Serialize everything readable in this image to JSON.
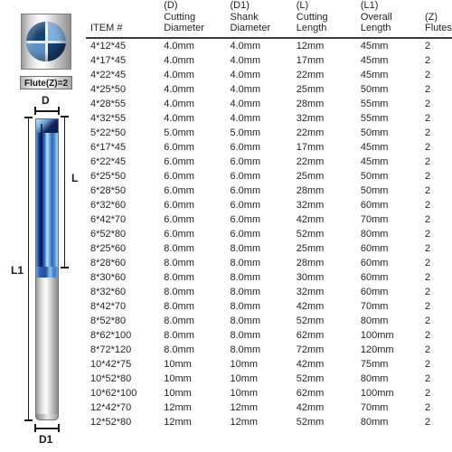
{
  "diagram": {
    "cross_section_caption": "Flute(Z)=2",
    "dimensions": {
      "cutting_diameter": "D",
      "shank_diameter": "D1",
      "cutting_length": "L",
      "overall_length": "L1"
    },
    "colors": {
      "coating_dark": "#0e1f6b",
      "coating_mid": "#2f6fc4",
      "coating_light": "#bfe0f4",
      "shank_steel": "#dadada",
      "outline": "#6f6f6f"
    }
  },
  "table": {
    "headers": [
      {
        "code": "",
        "line1": "",
        "line2": "ITEM #"
      },
      {
        "code": "(D)",
        "line1": "Cutting",
        "line2": "Diameter"
      },
      {
        "code": "(D1)",
        "line1": "Shank",
        "line2": "Diameter"
      },
      {
        "code": "(L)",
        "line1": "Cutting",
        "line2": "Length"
      },
      {
        "code": "(L1)",
        "line1": "Overall",
        "line2": "Length"
      },
      {
        "code": "(Z)",
        "line1": "",
        "line2": "Flutes"
      }
    ],
    "rows": [
      {
        "item": "4*12*45",
        "cutting_diameter": "4.0mm",
        "shank_diameter": "4.0mm",
        "cutting_length": "12mm",
        "overall_length": "45mm",
        "flutes": "2"
      },
      {
        "item": "4*17*45",
        "cutting_diameter": "4.0mm",
        "shank_diameter": "4.0mm",
        "cutting_length": "17mm",
        "overall_length": "45mm",
        "flutes": "2"
      },
      {
        "item": "4*22*45",
        "cutting_diameter": "4.0mm",
        "shank_diameter": "4.0mm",
        "cutting_length": "22mm",
        "overall_length": "45mm",
        "flutes": "2"
      },
      {
        "item": "4*25*50",
        "cutting_diameter": "4.0mm",
        "shank_diameter": "4.0mm",
        "cutting_length": "25mm",
        "overall_length": "50mm",
        "flutes": "2"
      },
      {
        "item": "4*28*55",
        "cutting_diameter": "4.0mm",
        "shank_diameter": "4.0mm",
        "cutting_length": "28mm",
        "overall_length": "55mm",
        "flutes": "2"
      },
      {
        "item": "4*32*55",
        "cutting_diameter": "4.0mm",
        "shank_diameter": "4.0mm",
        "cutting_length": "32mm",
        "overall_length": "55mm",
        "flutes": "2"
      },
      {
        "item": "5*22*50",
        "cutting_diameter": "5.0mm",
        "shank_diameter": "5.0mm",
        "cutting_length": "22mm",
        "overall_length": "50mm",
        "flutes": "2"
      },
      {
        "item": "6*17*45",
        "cutting_diameter": "6.0mm",
        "shank_diameter": "6.0mm",
        "cutting_length": "17mm",
        "overall_length": "45mm",
        "flutes": "2"
      },
      {
        "item": "6*22*45",
        "cutting_diameter": "6.0mm",
        "shank_diameter": "6.0mm",
        "cutting_length": "22mm",
        "overall_length": "45mm",
        "flutes": "2"
      },
      {
        "item": "6*25*50",
        "cutting_diameter": "6.0mm",
        "shank_diameter": "6.0mm",
        "cutting_length": "25mm",
        "overall_length": "50mm",
        "flutes": "2"
      },
      {
        "item": "6*28*50",
        "cutting_diameter": "6.0mm",
        "shank_diameter": "6.0mm",
        "cutting_length": "28mm",
        "overall_length": "50mm",
        "flutes": "2"
      },
      {
        "item": "6*32*60",
        "cutting_diameter": "6.0mm",
        "shank_diameter": "6.0mm",
        "cutting_length": "32mm",
        "overall_length": "60mm",
        "flutes": "2"
      },
      {
        "item": "6*42*70",
        "cutting_diameter": "6.0mm",
        "shank_diameter": "6.0mm",
        "cutting_length": "42mm",
        "overall_length": "70mm",
        "flutes": "2"
      },
      {
        "item": "6*52*80",
        "cutting_diameter": "6.0mm",
        "shank_diameter": "6.0mm",
        "cutting_length": "52mm",
        "overall_length": "80mm",
        "flutes": "2"
      },
      {
        "item": "8*25*60",
        "cutting_diameter": "8.0mm",
        "shank_diameter": "8.0mm",
        "cutting_length": "25mm",
        "overall_length": "60mm",
        "flutes": "2"
      },
      {
        "item": "8*28*60",
        "cutting_diameter": "8.0mm",
        "shank_diameter": "8.0mm",
        "cutting_length": "28mm",
        "overall_length": "60mm",
        "flutes": "2"
      },
      {
        "item": "8*30*60",
        "cutting_diameter": "8.0mm",
        "shank_diameter": "8.0mm",
        "cutting_length": "30mm",
        "overall_length": "60mm",
        "flutes": "2"
      },
      {
        "item": "8*32*60",
        "cutting_diameter": "8.0mm",
        "shank_diameter": "8.0mm",
        "cutting_length": "32mm",
        "overall_length": "60mm",
        "flutes": "2"
      },
      {
        "item": "8*42*70",
        "cutting_diameter": "8.0mm",
        "shank_diameter": "8.0mm",
        "cutting_length": "42mm",
        "overall_length": "70mm",
        "flutes": "2"
      },
      {
        "item": "8*52*80",
        "cutting_diameter": "8.0mm",
        "shank_diameter": "8.0mm",
        "cutting_length": "52mm",
        "overall_length": "80mm",
        "flutes": "2"
      },
      {
        "item": "8*62*100",
        "cutting_diameter": "8.0mm",
        "shank_diameter": "8.0mm",
        "cutting_length": "62mm",
        "overall_length": "100mm",
        "flutes": "2"
      },
      {
        "item": "8*72*120",
        "cutting_diameter": "8.0mm",
        "shank_diameter": "8.0mm",
        "cutting_length": "72mm",
        "overall_length": "120mm",
        "flutes": "2"
      },
      {
        "item": "10*42*75",
        "cutting_diameter": "10mm",
        "shank_diameter": "10mm",
        "cutting_length": "42mm",
        "overall_length": "75mm",
        "flutes": "2"
      },
      {
        "item": "10*52*80",
        "cutting_diameter": "10mm",
        "shank_diameter": "10mm",
        "cutting_length": "52mm",
        "overall_length": "80mm",
        "flutes": "2"
      },
      {
        "item": "10*62*100",
        "cutting_diameter": "10mm",
        "shank_diameter": "10mm",
        "cutting_length": "62mm",
        "overall_length": "100mm",
        "flutes": "2"
      },
      {
        "item": "12*42*70",
        "cutting_diameter": "12mm",
        "shank_diameter": "12mm",
        "cutting_length": "42mm",
        "overall_length": "70mm",
        "flutes": "2"
      },
      {
        "item": "12*52*80",
        "cutting_diameter": "12mm",
        "shank_diameter": "12mm",
        "cutting_length": "52mm",
        "overall_length": "80mm",
        "flutes": "2"
      }
    ]
  }
}
